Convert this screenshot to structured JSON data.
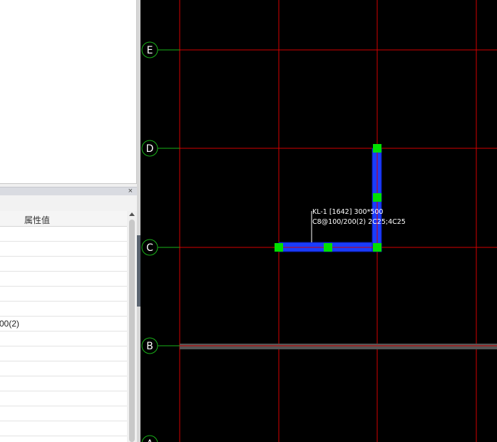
{
  "properties_panel": {
    "close_glyph": "×",
    "header_value_label": "属性值",
    "rows": [
      "",
      "",
      "",
      "",
      "",
      "",
      "00(2)",
      "",
      "",
      "",
      "",
      "",
      "",
      "",
      ""
    ]
  },
  "canvas": {
    "axis_labels": [
      "E",
      "D",
      "C",
      "B",
      "A"
    ],
    "beam_annotation": {
      "line1": "KL-1 [1642] 300*500",
      "line2": "C8@100/200(2) 2C25;4C25"
    },
    "colors": {
      "background": "#000000",
      "grid_line": "#d40000",
      "axis_bubble": "#19b219",
      "beam_fill": "#1a3cff",
      "beam_node": "#00e000",
      "annotation_text": "#ffffff"
    }
  }
}
